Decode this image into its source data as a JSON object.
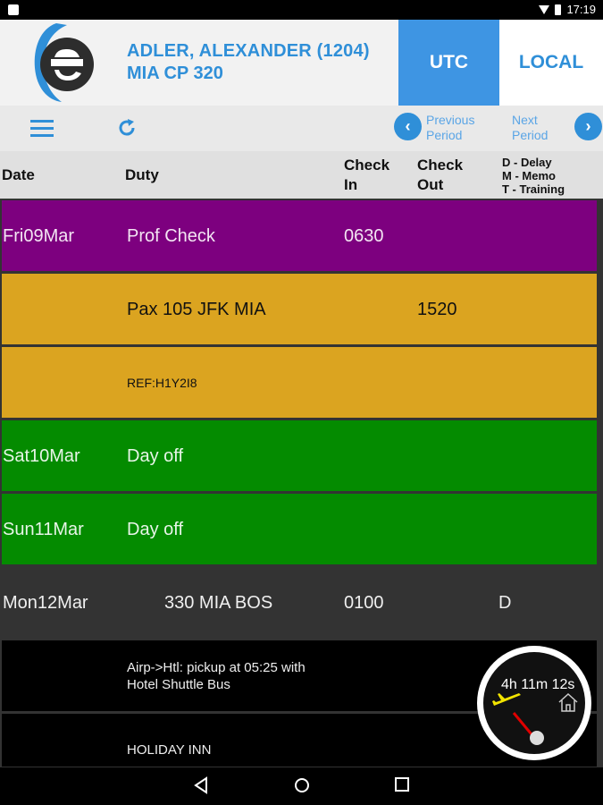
{
  "status_bar": {
    "time": "17:19"
  },
  "header": {
    "crew_name": "ADLER, ALEXANDER (1204)",
    "crew_base": "MIA CP 320",
    "utc_label": "UTC",
    "local_label": "LOCAL"
  },
  "toolbar": {
    "prev_line1": "Previous",
    "prev_line2": "Period",
    "next_line1": "Next",
    "next_line2": "Period"
  },
  "columns": {
    "date": "Date",
    "duty": "Duty",
    "checkin_1": "Check",
    "checkin_2": "In",
    "checkout_1": "Check",
    "checkout_2": "Out",
    "legend_1": "D - Delay",
    "legend_2": "M - Memo",
    "legend_3": "T - Training"
  },
  "rows": [
    {
      "date": "Fri09Mar",
      "duty": "Prof Check",
      "check_in": "0630",
      "check_out": "",
      "flag": ""
    },
    {
      "date": "",
      "duty": "Pax 105 JFK MIA",
      "check_in": "",
      "check_out": "1520",
      "flag": ""
    },
    {
      "date": "",
      "duty": "REF:H1Y2I8",
      "check_in": "",
      "check_out": "",
      "flag": ""
    },
    {
      "date": "Sat10Mar",
      "duty": "Day off",
      "check_in": "",
      "check_out": "",
      "flag": ""
    },
    {
      "date": "Sun11Mar",
      "duty": "Day off",
      "check_in": "",
      "check_out": "",
      "flag": ""
    },
    {
      "date": "Mon12Mar",
      "duty": "330 MIA BOS",
      "check_in": "0100",
      "check_out": "",
      "flag": "D"
    },
    {
      "date": "",
      "duty_line1": "Airp->Htl: pickup at 05:25 with",
      "duty_line2": "Hotel Shuttle Bus"
    },
    {
      "date": "",
      "duty": "HOLIDAY INN"
    }
  ],
  "timer": {
    "remaining": "4h 11m 12s"
  },
  "colors": {
    "accent": "#2f8fd8",
    "utc_active": "#3e95e3",
    "training": "#7d007f",
    "deadhead": "#dba420",
    "day_off": "#048b00"
  }
}
